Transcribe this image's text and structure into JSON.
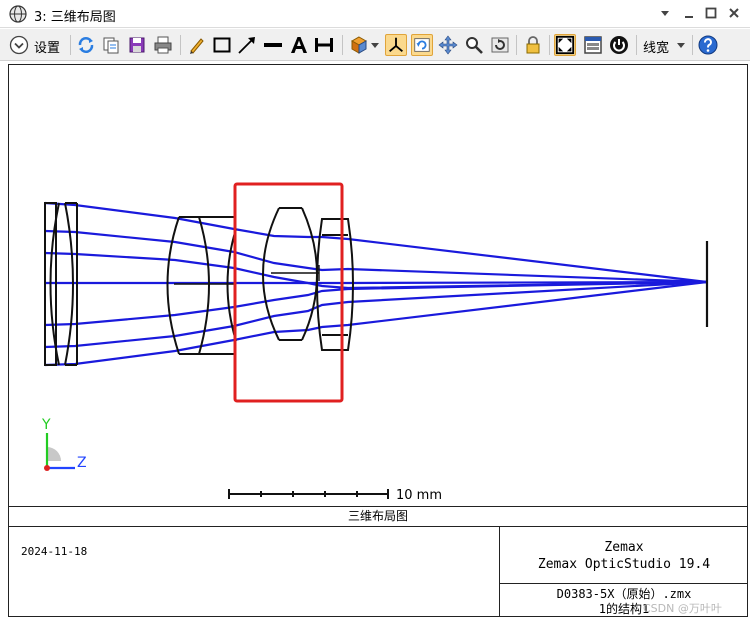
{
  "window": {
    "title": "3: 三维布局图",
    "controls": [
      "dropdown",
      "minimize",
      "maximize",
      "close"
    ]
  },
  "toolbar": {
    "settings_label": "设置",
    "linewidth_label": "线宽",
    "buttons": [
      "settings-icon",
      "refresh-icon",
      "copy-icon",
      "save-icon",
      "print-icon",
      "pencil-icon",
      "rectangle-icon",
      "arrow-icon",
      "line-icon",
      "text-icon",
      "dimension-icon",
      "rotate-view-icon",
      "axes-icon",
      "rotate-icon",
      "pan-icon",
      "zoom-icon",
      "reset-view-icon",
      "lock-icon",
      "fit-icon",
      "window-icon",
      "power-icon",
      "help-icon"
    ],
    "active_buttons": [
      "axes-icon",
      "rotate-icon",
      "fit-icon"
    ]
  },
  "colors": {
    "ray": "#1a1adc",
    "lens": "#111111",
    "highlight": "#e02020",
    "axis_y": "#22cc22",
    "axis_z": "#2244ff",
    "axis_x": "#dd2222",
    "toolbar_bg": "#f0f0f0",
    "active_button": "#fbd98d"
  },
  "layout_plot": {
    "axes": [
      "Y",
      "Z"
    ],
    "scale_bar_label": "10 mm",
    "field_count": 3,
    "highlight_box": "red"
  },
  "title_block": {
    "caption": "三维布局图",
    "date": "2024-11-18",
    "vendor": "Zemax",
    "product": "Zemax OpticStudio 19.4",
    "file": "D0383-5X（原始）.zmx",
    "config": "1的结构1"
  },
  "watermark": "CSDN @万叶叶"
}
